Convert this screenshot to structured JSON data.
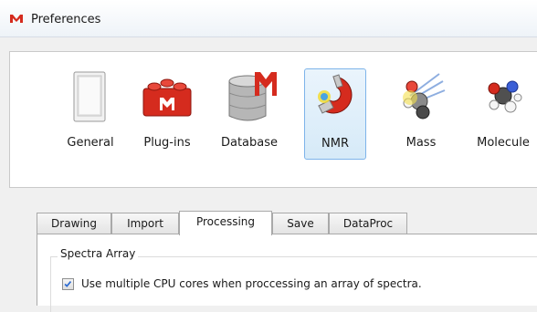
{
  "window": {
    "title": "Preferences"
  },
  "toolbar": {
    "items": [
      {
        "label": "General",
        "icon": "general-icon"
      },
      {
        "label": "Plug-ins",
        "icon": "plugins-icon"
      },
      {
        "label": "Database",
        "icon": "database-icon"
      },
      {
        "label": "NMR",
        "icon": "nmr-magnet-icon",
        "selected": true
      },
      {
        "label": "Mass",
        "icon": "mass-spec-icon"
      },
      {
        "label": "Molecule",
        "icon": "molecule-icon"
      }
    ]
  },
  "tabs": [
    {
      "label": "Drawing"
    },
    {
      "label": "Import"
    },
    {
      "label": "Processing",
      "active": true
    },
    {
      "label": "Save"
    },
    {
      "label": "DataProc"
    }
  ],
  "panel": {
    "group_title": "Spectra Array",
    "checkbox_label": "Use multiple CPU cores when proccessing an array of spectra.",
    "checkbox_checked": true
  },
  "colors": {
    "accent": "#d52b1e",
    "selection": "#7eb4ea",
    "check": "#2b6ad1"
  }
}
